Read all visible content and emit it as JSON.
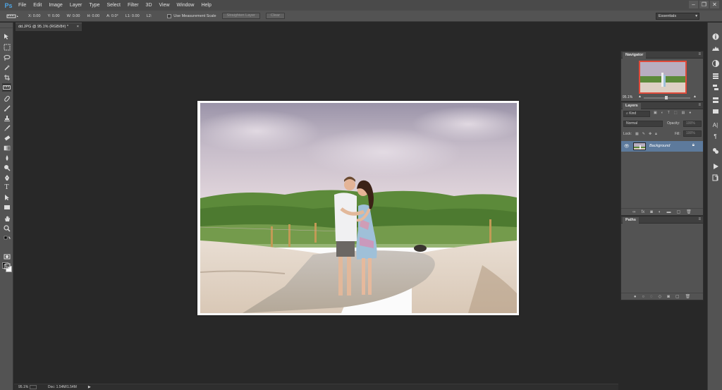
{
  "app": {
    "logo": "Ps",
    "menu": [
      "File",
      "Edit",
      "Image",
      "Layer",
      "Type",
      "Select",
      "Filter",
      "3D",
      "View",
      "Window",
      "Help"
    ],
    "window_controls": [
      "–",
      "❐",
      "✕"
    ]
  },
  "options_bar": {
    "fields": [
      "X: 0.00",
      "Y: 0.00",
      "W: 0.00",
      "H: 0.00",
      "A: 0.0°",
      "L1: 0.00",
      "L2:"
    ],
    "checkbox_label": "Use Measurement Scale",
    "straighten_label": "Straighten Layer",
    "clear_label": "Clear",
    "workspace": "Essentials"
  },
  "document": {
    "tab_title": "dd.JPG @ 95.1% (RGB/8#) *",
    "close": "×"
  },
  "status": {
    "zoom": "95.1%",
    "doc_size": "Doc: 1.54M/1.54M",
    "arrow": "▶"
  },
  "navigator": {
    "title": "Navigator",
    "zoom": "95.1%"
  },
  "layers": {
    "title": "Layers",
    "kind_label": "Kind",
    "blend_mode": "Normal",
    "opacity_label": "Opacity:",
    "opacity_value": "100%",
    "lock_label": "Lock:",
    "fill_label": "Fill:",
    "fill_value": "100%",
    "items": [
      {
        "name": "Background"
      }
    ]
  },
  "paths": {
    "title": "Paths"
  },
  "colors": {
    "foreground": "#000000",
    "background": "#ffffff",
    "accent": "#e04a3a",
    "selected_layer": "#5d7a9c"
  }
}
